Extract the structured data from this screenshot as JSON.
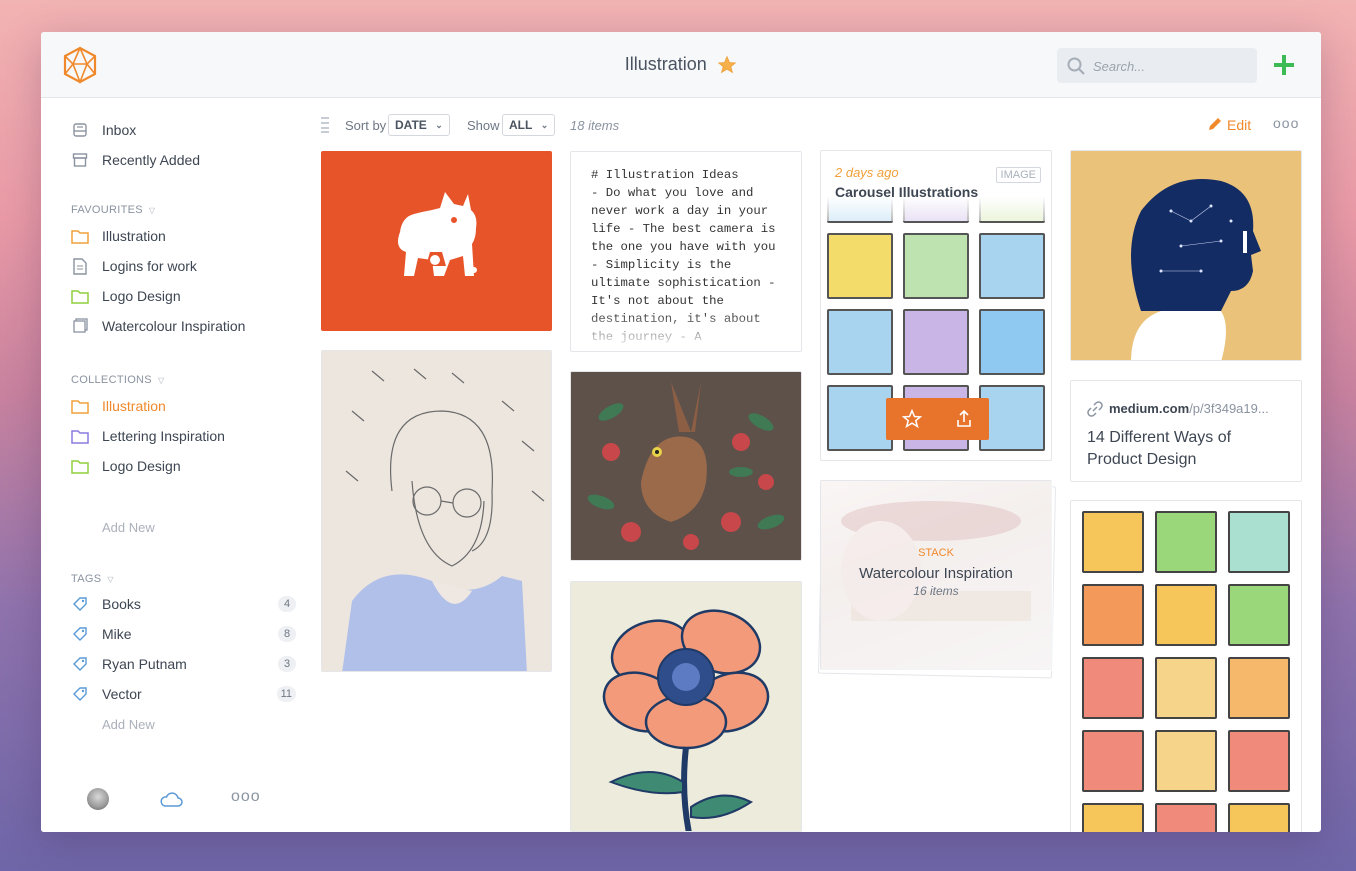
{
  "header": {
    "title": "Illustration",
    "search_placeholder": "Search..."
  },
  "sidebar": {
    "primary": [
      {
        "label": "Inbox",
        "icon": "inbox-icon"
      },
      {
        "label": "Recently Added",
        "icon": "archive-icon"
      }
    ],
    "favourites_label": "FAVOURITES",
    "favourites": [
      {
        "label": "Illustration",
        "icon": "folder-icon",
        "color": "#f0a03a"
      },
      {
        "label": "Logins for work",
        "icon": "document-icon",
        "color": "#8a93a0"
      },
      {
        "label": "Logo Design",
        "icon": "folder-icon",
        "color": "#8fcf3c"
      },
      {
        "label": "Watercolour Inspiration",
        "icon": "stack-icon",
        "color": "#8a93a0"
      }
    ],
    "collections_label": "COLLECTIONS",
    "collections": [
      {
        "label": "Illustration",
        "icon": "folder-icon",
        "color": "#f0a03a",
        "active": true
      },
      {
        "label": "Lettering Inspiration",
        "icon": "folder-icon",
        "color": "#8a7ce0"
      },
      {
        "label": "Logo Design",
        "icon": "folder-icon",
        "color": "#8fcf3c"
      }
    ],
    "collections_add": "Add New",
    "tags_label": "TAGS",
    "tags": [
      {
        "label": "Books",
        "count": "4"
      },
      {
        "label": "Mike",
        "count": "8"
      },
      {
        "label": "Ryan Putnam",
        "count": "3"
      },
      {
        "label": "Vector",
        "count": "11"
      }
    ],
    "tags_add": "Add New",
    "footer_more": "ooo"
  },
  "toolbar": {
    "sort_label": "Sort by",
    "sort_value": "DATE",
    "show_label": "Show",
    "show_value": "ALL",
    "items_count": "18 items",
    "edit_label": "Edit",
    "more_label": "ooo"
  },
  "cards": {
    "note": {
      "text": "# Illustration Ideas\n- Do what you love and never work a day in your life - The best camera is the one you have with you - Simplicity is the ultimate sophistication - It's not about the destination, it's about the journey - A"
    },
    "carousel": {
      "date": "2 days ago",
      "title": "Carousel Illustrations",
      "badge": "IMAGE"
    },
    "stack": {
      "kind": "STACK",
      "title": "Watercolour Inspiration",
      "count": "16 items"
    },
    "link": {
      "domain": "medium.com",
      "path": "/p/3f349a19...",
      "title": "14 Different Ways of Product Design"
    }
  },
  "colors": {
    "accent": "#f0892b",
    "brand_orange": "#e8542a",
    "add_green": "#3cba54"
  }
}
